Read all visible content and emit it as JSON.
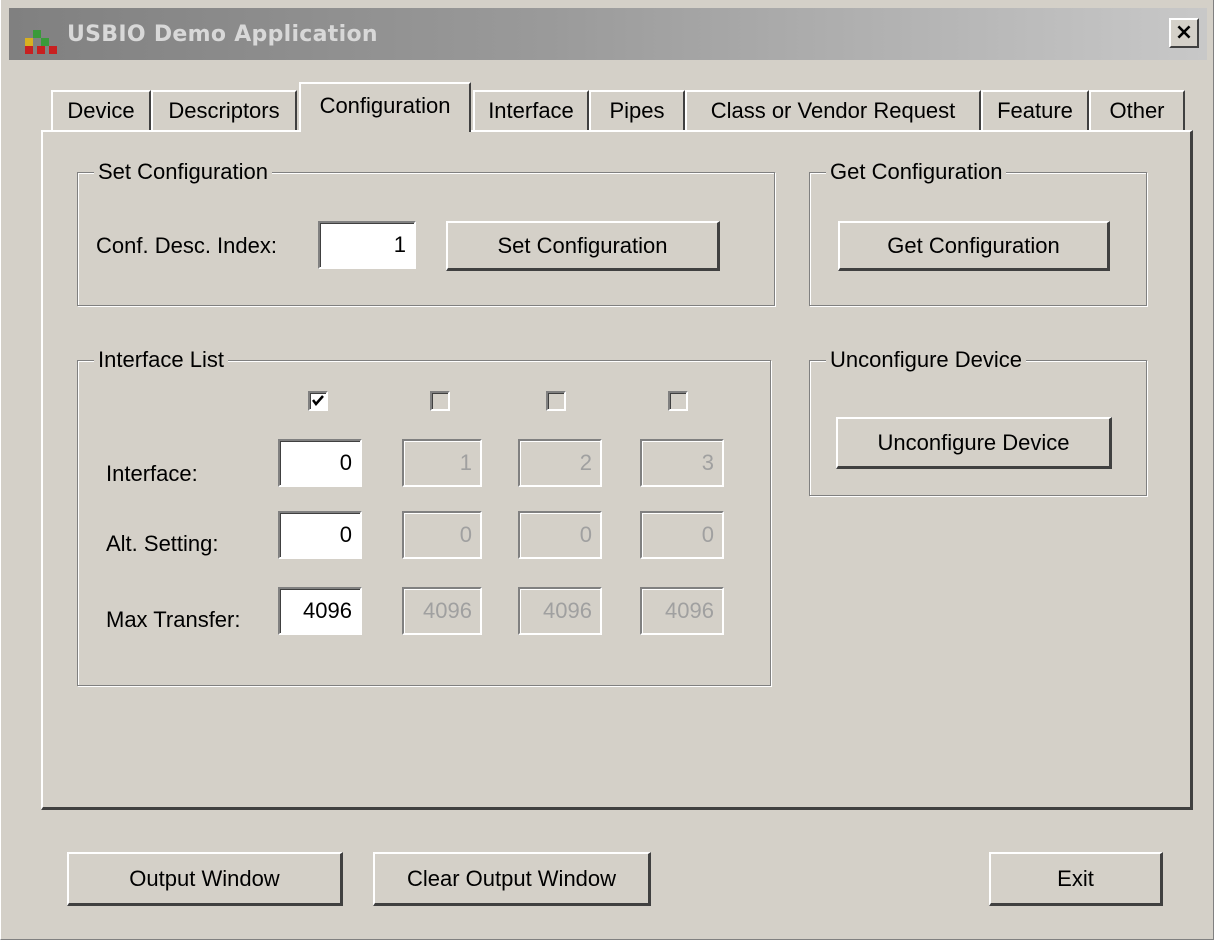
{
  "window": {
    "title": "USBIO Demo Application",
    "close_label": "×"
  },
  "tabs": [
    {
      "label": "Device",
      "active": false
    },
    {
      "label": "Descriptors",
      "active": false
    },
    {
      "label": "Configuration",
      "active": true
    },
    {
      "label": "Interface",
      "active": false
    },
    {
      "label": "Pipes",
      "active": false
    },
    {
      "label": "Class or Vendor Request",
      "active": false
    },
    {
      "label": "Feature",
      "active": false
    },
    {
      "label": "Other",
      "active": false
    }
  ],
  "set_configuration": {
    "group_label": "Set Configuration",
    "index_label": "Conf. Desc. Index:",
    "index_value": "1",
    "button_label": "Set Configuration"
  },
  "get_configuration": {
    "group_label": "Get Configuration",
    "button_label": "Get Configuration"
  },
  "unconfigure": {
    "group_label": "Unconfigure Device",
    "button_label": "Unconfigure Device"
  },
  "interface_list": {
    "group_label": "Interface List",
    "row_labels": {
      "interface": "Interface:",
      "alt_setting": "Alt. Setting:",
      "max_transfer": "Max Transfer:"
    },
    "columns": [
      {
        "checked": true,
        "enabled": true,
        "interface": "0",
        "alt_setting": "0",
        "max_transfer": "4096"
      },
      {
        "checked": false,
        "enabled": false,
        "interface": "1",
        "alt_setting": "0",
        "max_transfer": "4096"
      },
      {
        "checked": false,
        "enabled": false,
        "interface": "2",
        "alt_setting": "0",
        "max_transfer": "4096"
      },
      {
        "checked": false,
        "enabled": false,
        "interface": "3",
        "alt_setting": "0",
        "max_transfer": "4096"
      }
    ]
  },
  "footer": {
    "output_window": "Output Window",
    "clear_output_window": "Clear Output Window",
    "exit": "Exit"
  },
  "icons": {
    "app": "usbio-app-icon",
    "check": "checkmark-icon"
  }
}
